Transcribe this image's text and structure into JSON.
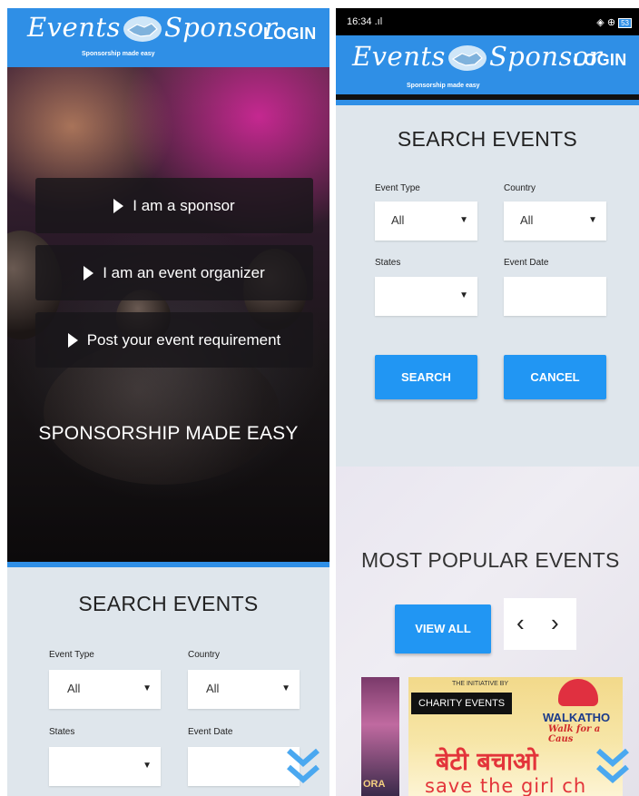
{
  "app": {
    "logo_text_1": "Events",
    "logo_text_2": "Sponsor",
    "tagline": "Sponsorship made easy",
    "login_label": "LOGIN",
    "brand_color": "#2f8fe6",
    "button_color": "#2196f3"
  },
  "status_bar": {
    "time": "16:34",
    "signal": ".ıl",
    "icons": "◈ ⊕",
    "battery": "53"
  },
  "hero": {
    "buttons": [
      {
        "label": "I am a sponsor",
        "icon": "play-triangle-icon"
      },
      {
        "label": "I am an event organizer",
        "icon": "play-triangle-icon"
      },
      {
        "label": "Post your event requirement",
        "icon": "play-triangle-icon"
      }
    ],
    "slogan": "SPONSORSHIP MADE EASY"
  },
  "search": {
    "title": "SEARCH EVENTS",
    "event_type": {
      "label": "Event Type",
      "value": "All"
    },
    "country": {
      "label": "Country",
      "value": "All"
    },
    "states": {
      "label": "States",
      "value": ""
    },
    "event_date": {
      "label": "Event Date",
      "value": ""
    },
    "search_label": "SEARCH",
    "cancel_label": "CANCEL",
    "caret": "▼"
  },
  "popular": {
    "title": "MOST POPULAR EVENTS",
    "view_all_label": "VIEW ALL",
    "prev": "‹",
    "next": "›",
    "card_badge": "CHARITY EVENTS",
    "card_initiative": "THE INITIATIVE BY",
    "card_hindi": "बेटी बचाओ",
    "card_save": "save the girl ch",
    "card_walk": "WALKATHO",
    "card_walk_sub": "Walk for a Caus",
    "card_left_text": "ORA"
  }
}
